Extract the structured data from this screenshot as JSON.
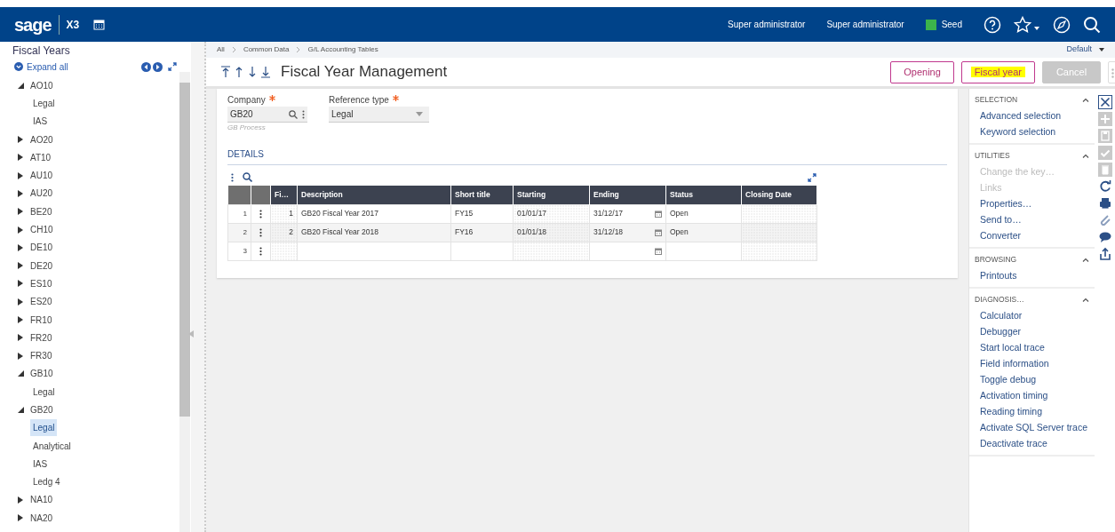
{
  "header": {
    "logo": "sage",
    "product": "X3",
    "users": [
      "Super administrator",
      "Super administrator"
    ],
    "folder": {
      "label": "Seed",
      "color": "#3cb44b"
    }
  },
  "tree": {
    "title": "Fiscal Years",
    "expand_all": "Expand all",
    "items": [
      {
        "label": "AO10",
        "expanded": true,
        "selected": false,
        "children": [
          {
            "label": "Legal",
            "selected": false
          },
          {
            "label": "IAS",
            "selected": false
          }
        ]
      },
      {
        "label": "AO20",
        "expanded": false,
        "selected": false
      },
      {
        "label": "AT10",
        "expanded": false,
        "selected": false
      },
      {
        "label": "AU10",
        "expanded": false,
        "selected": false
      },
      {
        "label": "AU20",
        "expanded": false,
        "selected": false
      },
      {
        "label": "BE20",
        "expanded": false,
        "selected": false
      },
      {
        "label": "CH10",
        "expanded": false,
        "selected": false
      },
      {
        "label": "DE10",
        "expanded": false,
        "selected": false
      },
      {
        "label": "DE20",
        "expanded": false,
        "selected": false
      },
      {
        "label": "ES10",
        "expanded": false,
        "selected": false
      },
      {
        "label": "ES20",
        "expanded": false,
        "selected": false
      },
      {
        "label": "FR10",
        "expanded": false,
        "selected": false
      },
      {
        "label": "FR20",
        "expanded": false,
        "selected": false
      },
      {
        "label": "FR30",
        "expanded": false,
        "selected": false
      },
      {
        "label": "GB10",
        "expanded": true,
        "selected": false,
        "children": [
          {
            "label": "Legal",
            "selected": false
          }
        ]
      },
      {
        "label": "GB20",
        "expanded": true,
        "selected": false,
        "children": [
          {
            "label": "Legal",
            "selected": true
          },
          {
            "label": "Analytical",
            "selected": false
          },
          {
            "label": "IAS",
            "selected": false
          },
          {
            "label": "Ledg 4",
            "selected": false
          }
        ]
      },
      {
        "label": "NA10",
        "expanded": false,
        "selected": false
      },
      {
        "label": "NA20",
        "expanded": false,
        "selected": false
      }
    ]
  },
  "breadcrumb": [
    "All",
    "Common Data",
    "G/L Accounting Tables"
  ],
  "view": "Default",
  "title": "Fiscal Year Management",
  "buttons": [
    {
      "label": "Opening",
      "highlighted": false,
      "disabled": false
    },
    {
      "label": "Fiscal year",
      "highlighted": true,
      "disabled": false
    },
    {
      "label": "Cancel",
      "highlighted": false,
      "disabled": true
    }
  ],
  "form": {
    "company": {
      "label": "Company",
      "required": true,
      "value": "GB20",
      "description": "GB Process"
    },
    "reference_type": {
      "label": "Reference type",
      "required": true,
      "value": "Legal"
    }
  },
  "details": {
    "title": "DETAILS",
    "columns": [
      {
        "label": "Fi…",
        "kind": "number",
        "readonly": true
      },
      {
        "label": "Description",
        "kind": "text",
        "readonly": false
      },
      {
        "label": "Short title",
        "kind": "text",
        "readonly": false
      },
      {
        "label": "Starting",
        "kind": "date",
        "readonly": true
      },
      {
        "label": "Ending",
        "kind": "date",
        "readonly": false
      },
      {
        "label": "Status",
        "kind": "text",
        "readonly": false
      },
      {
        "label": "Closing Date",
        "kind": "date",
        "readonly": true
      }
    ],
    "rows": [
      {
        "number": "1",
        "cells": [
          "1",
          "GB20 Fiscal Year 2017",
          "FY15",
          "01/01/17",
          "31/12/17",
          "Open"
        ]
      },
      {
        "number": "2",
        "cells": [
          "2",
          "GB20 Fiscal Year 2018",
          "FY16",
          "01/01/18",
          "31/12/18",
          "Open"
        ]
      },
      {
        "number": "3"
      }
    ]
  },
  "side_panel": [
    {
      "title": "SELECTION",
      "expanded": true,
      "items": [
        {
          "label": "Advanced selection",
          "disabled": false
        },
        {
          "label": "Keyword selection",
          "disabled": false
        }
      ]
    },
    {
      "title": "UTILITIES",
      "expanded": true,
      "items": [
        {
          "label": "Change the key…",
          "disabled": true
        },
        {
          "label": "Links",
          "disabled": true
        },
        {
          "label": "Properties…",
          "disabled": false
        },
        {
          "label": "Send to…",
          "disabled": false
        },
        {
          "label": "Converter",
          "disabled": false
        }
      ]
    },
    {
      "title": "BROWSING",
      "expanded": true,
      "items": [
        {
          "label": "Printouts",
          "disabled": false
        }
      ]
    },
    {
      "title": "DIAGNOSIS…",
      "expanded": true,
      "items": [
        {
          "label": "Calculator",
          "disabled": false
        },
        {
          "label": "Debugger",
          "disabled": false
        },
        {
          "label": "Start local trace",
          "disabled": false
        },
        {
          "label": "Field information",
          "disabled": false
        },
        {
          "label": "Toggle debug",
          "disabled": false
        },
        {
          "label": "Activation timing",
          "disabled": false
        },
        {
          "label": "Reading timing",
          "disabled": false
        },
        {
          "label": "Activate SQL Server trace",
          "disabled": false
        },
        {
          "label": "Deactivate trace",
          "disabled": false
        }
      ]
    }
  ],
  "toolbar": [
    {
      "kind": "close",
      "disabled": false
    },
    {
      "kind": "add",
      "disabled": true
    },
    {
      "kind": "save",
      "disabled": true
    },
    {
      "kind": "check",
      "disabled": true
    },
    {
      "kind": "delete",
      "disabled": true
    },
    {
      "kind": "refresh",
      "disabled": false
    },
    {
      "kind": "print",
      "disabled": false
    },
    {
      "kind": "attach",
      "disabled": false
    },
    {
      "kind": "comment",
      "disabled": false
    },
    {
      "kind": "share",
      "disabled": false
    }
  ]
}
